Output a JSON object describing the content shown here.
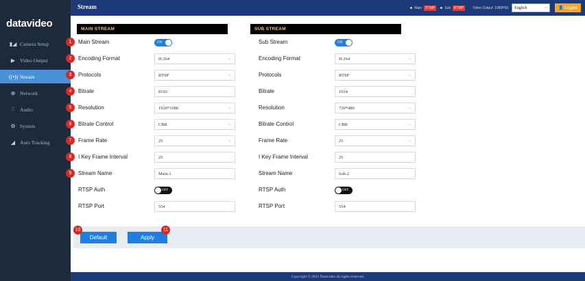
{
  "brand": "datavideo",
  "sidebar": {
    "items": [
      {
        "icon": "camera-icon",
        "glyph": "▮◢",
        "label": "Camera Setup",
        "active": false
      },
      {
        "icon": "video-output-icon",
        "glyph": "▶",
        "label": "Video Output",
        "active": false
      },
      {
        "icon": "stream-icon",
        "glyph": "((•))",
        "label": "Stream",
        "active": true
      },
      {
        "icon": "network-icon",
        "glyph": "⊕",
        "label": "Network",
        "active": false
      },
      {
        "icon": "audio-icon",
        "glyph": "⫶⫶",
        "label": "Audio",
        "active": false
      },
      {
        "icon": "system-icon",
        "glyph": "⚙",
        "label": "System",
        "active": false
      },
      {
        "icon": "auto-tracking-icon",
        "glyph": "◢",
        "label": "Auto Tracking",
        "active": false
      }
    ]
  },
  "header": {
    "title": "Stream",
    "main_label": "Main",
    "main_badge": "RTMP",
    "sub_label": "Sub",
    "sub_badge": "RTMP",
    "video_output": "Video Output: 1080P60",
    "language": "English",
    "logout": "Logout"
  },
  "main_stream": {
    "heading": "MAIN STREAM",
    "rows": [
      {
        "num": "1",
        "label": "Main Stream",
        "type": "toggle",
        "value": "ON"
      },
      {
        "num": "2",
        "label": "Encoding Format",
        "type": "select",
        "value": "H.264"
      },
      {
        "num": "3",
        "label": "Protocols",
        "type": "select",
        "value": "RTSP"
      },
      {
        "num": "4",
        "label": "Bitrate",
        "type": "input",
        "value": "8192"
      },
      {
        "num": "5",
        "label": "Resolution",
        "type": "select",
        "value": "1920*1080"
      },
      {
        "num": "6",
        "label": "Bitrate Control",
        "type": "select",
        "value": "CBR"
      },
      {
        "num": "7",
        "label": "Frame Rate",
        "type": "select",
        "value": "25"
      },
      {
        "num": "8",
        "label": "I Key Frame Interval",
        "type": "input",
        "value": "25"
      },
      {
        "num": "9",
        "label": "Stream Name",
        "type": "input",
        "value": "Main.1"
      },
      {
        "num": "",
        "label": "RTSP Auth",
        "type": "toggle",
        "value": "OFF"
      },
      {
        "num": "",
        "label": "RTSP Port",
        "type": "input",
        "value": "554"
      }
    ]
  },
  "sub_stream": {
    "heading": "SUB STREAM",
    "rows": [
      {
        "label": "Sub Stream",
        "type": "toggle",
        "value": "ON"
      },
      {
        "label": "Encoding Format",
        "type": "select",
        "value": "H.264"
      },
      {
        "label": "Protocols",
        "type": "select",
        "value": "RTSP"
      },
      {
        "label": "Bitrate",
        "type": "input",
        "value": "1024"
      },
      {
        "label": "Resolution",
        "type": "select",
        "value": "720*480"
      },
      {
        "label": "Bitrate Control",
        "type": "select",
        "value": "CBR"
      },
      {
        "label": "Frame Rate",
        "type": "select",
        "value": "25"
      },
      {
        "label": "I Key Frame Interval",
        "type": "input",
        "value": "25"
      },
      {
        "label": "Stream Name",
        "type": "input",
        "value": "Sub.2"
      },
      {
        "label": "RTSP Auth",
        "type": "toggle",
        "value": "OFF"
      },
      {
        "label": "RTSP Port",
        "type": "input",
        "value": "554"
      }
    ]
  },
  "actions": {
    "default_label": "Default",
    "default_num": "10",
    "apply_label": "Apply",
    "apply_num": "11"
  },
  "footer": "Copyright © 2023 Datavideo all rights reserved.",
  "colors": {
    "accent": "#1e7fe0",
    "sidebar": "#1c2a3c",
    "topbar": "#1c3a78",
    "badge": "#d72828",
    "rtmp": "#e53935",
    "logout": "#f5a623"
  }
}
